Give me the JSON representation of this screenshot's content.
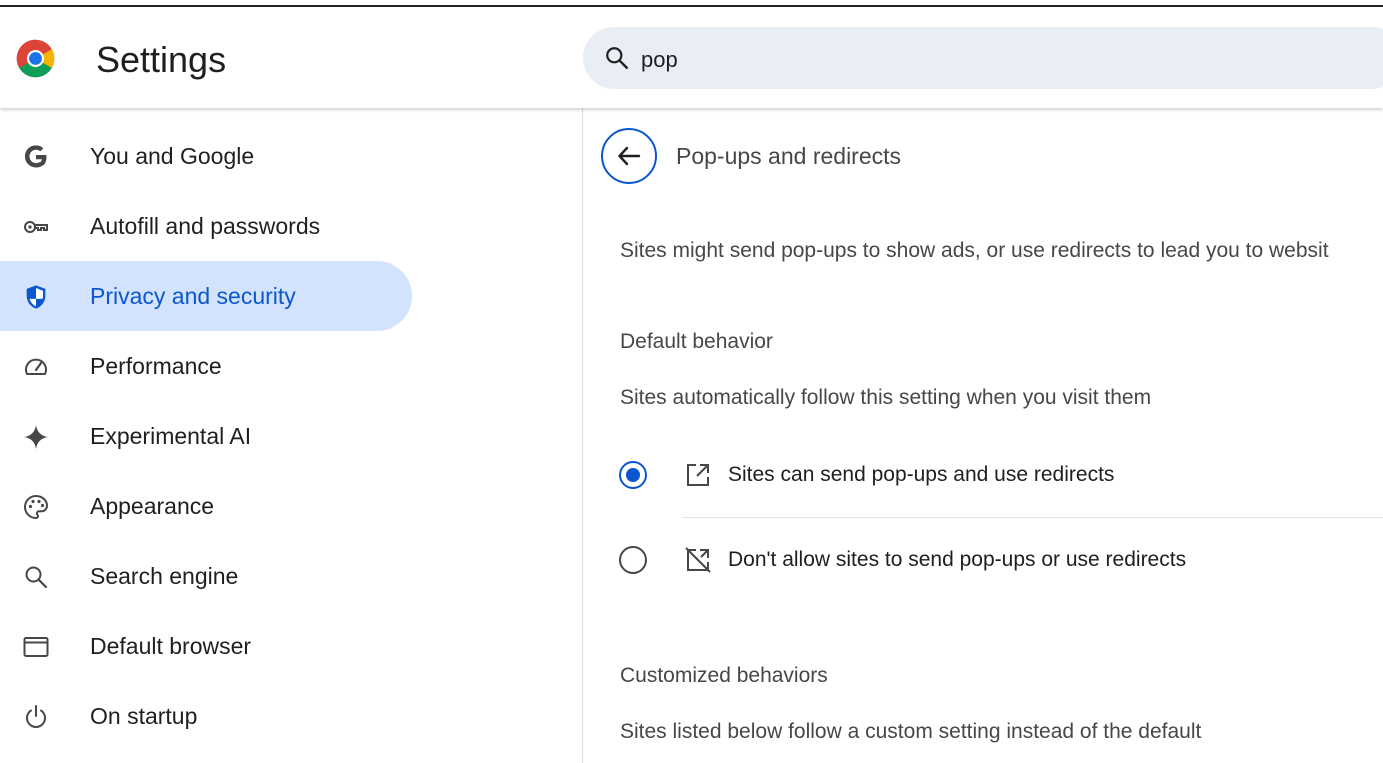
{
  "header": {
    "title": "Settings",
    "search_value": "pop"
  },
  "sidebar": {
    "items": [
      {
        "label": "You and Google"
      },
      {
        "label": "Autofill and passwords"
      },
      {
        "label": "Privacy and security"
      },
      {
        "label": "Performance"
      },
      {
        "label": "Experimental AI"
      },
      {
        "label": "Appearance"
      },
      {
        "label": "Search engine"
      },
      {
        "label": "Default browser"
      },
      {
        "label": "On startup"
      }
    ],
    "active_item": "Privacy and security"
  },
  "main": {
    "page_title": "Pop-ups and redirects",
    "description": "Sites might send pop-ups to show ads, or use redirects to lead you to websit",
    "default_behavior": {
      "title": "Default behavior",
      "subtitle": "Sites automatically follow this setting when you visit them",
      "options": [
        {
          "label": "Sites can send pop-ups and use redirects",
          "selected": true
        },
        {
          "label": "Don't allow sites to send pop-ups or use redirects",
          "selected": false
        }
      ]
    },
    "customized_behaviors": {
      "title": "Customized behaviors",
      "subtitle": "Sites listed below follow a custom setting instead of the default"
    }
  },
  "colors": {
    "accent": "#0b57d0",
    "active_bg": "#d3e3fd",
    "search_bg": "#e9eef6"
  }
}
